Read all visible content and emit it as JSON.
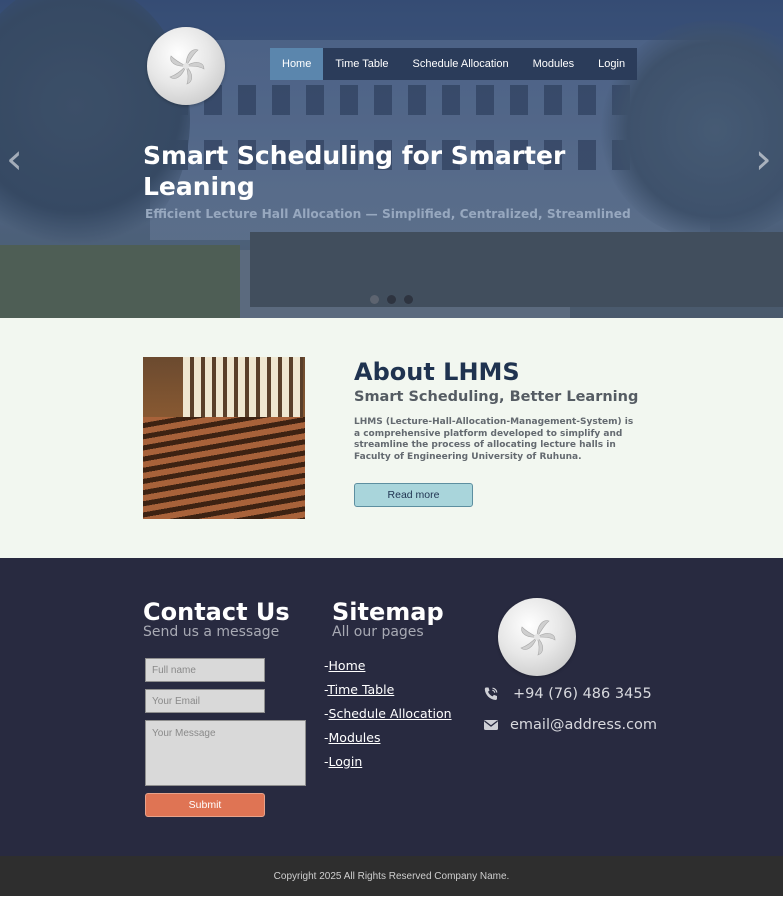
{
  "nav": {
    "items": [
      {
        "label": "Home",
        "active": true
      },
      {
        "label": "Time Table"
      },
      {
        "label": "Schedule Allocation"
      },
      {
        "label": "Modules"
      },
      {
        "label": "Login"
      }
    ]
  },
  "hero": {
    "title_line1": "Smart Scheduling for Smarter",
    "title_line2": "Leaning",
    "subtitle": "Efficient Lecture Hall Allocation — Simplified, Centralized, Streamlined",
    "prev_arrow": "‹",
    "next_arrow": "›",
    "slides": 3
  },
  "about": {
    "title": "About LHMS",
    "subtitle": "Smart Scheduling, Better Learning",
    "description": "LHMS (Lecture-Hall-Allocation-Management-System) is a comprehensive platform developed to simplify and streamline the process of allocating lecture halls in Faculty of Engineering University of Ruhuna.",
    "button_label": "Read more"
  },
  "contact": {
    "title": "Contact Us",
    "subtitle": "Send us a message",
    "name_placeholder": "Full name",
    "email_placeholder": "Your Email",
    "message_placeholder": "Your Message",
    "submit_label": "Submit"
  },
  "sitemap": {
    "title": "Sitemap",
    "subtitle": "All our pages",
    "links": [
      "Home",
      "Time Table",
      "Schedule Allocation",
      "Modules",
      "Login"
    ]
  },
  "info": {
    "phone": "+94 (76) 486 3455",
    "email": "email@address.com",
    "phone_icon": "phone-icon",
    "email_icon": "envelope-icon"
  },
  "footer": {
    "copyright": "Copyright 2025 All Rights Reserved Company Name."
  },
  "colors": {
    "nav_bg": "#2b3c5a",
    "nav_active": "#5b86ad",
    "about_title": "#1f3350",
    "read_more_bg": "#a9d5db",
    "footer_bg": "#282a40",
    "submit_bg": "#df7454",
    "copyright_bg": "#2e2e2e"
  }
}
